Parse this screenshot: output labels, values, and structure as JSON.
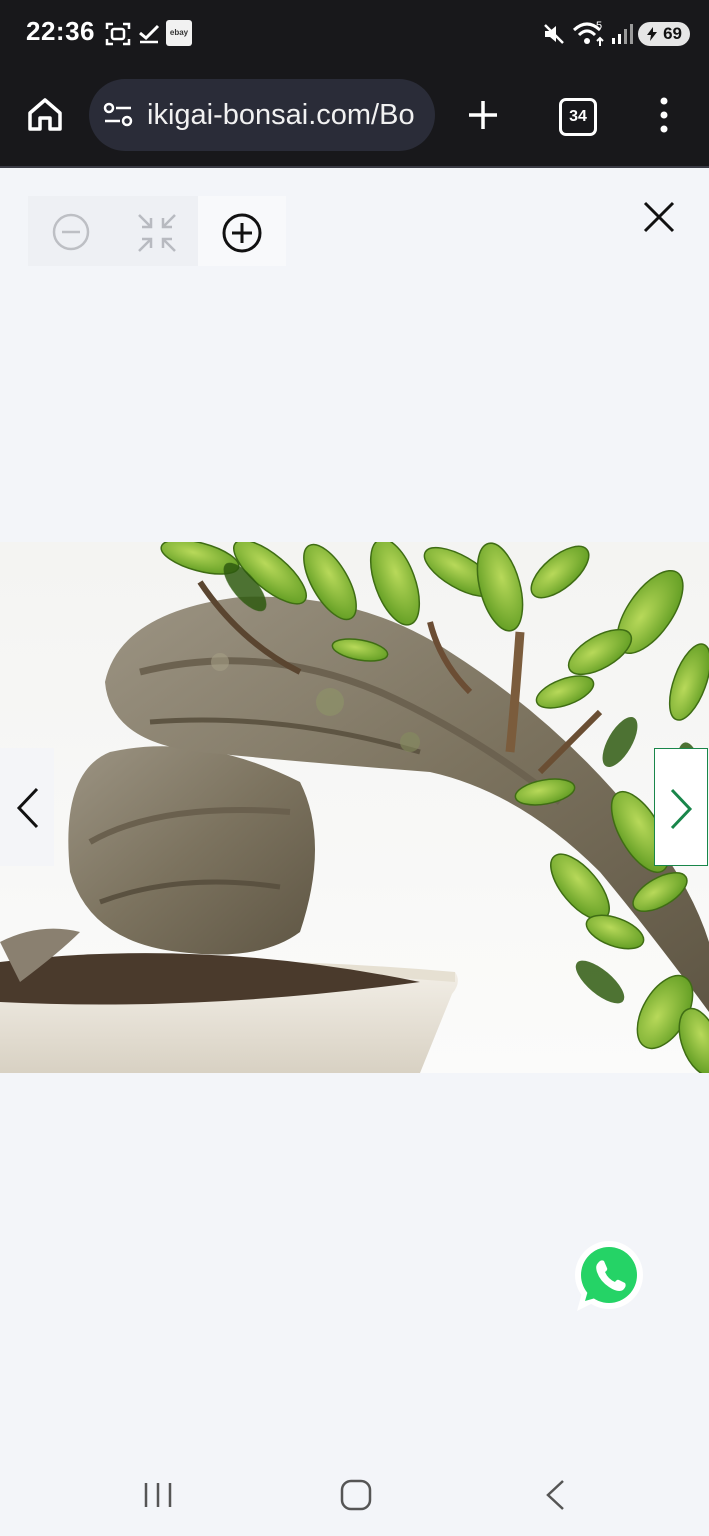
{
  "status_bar": {
    "time": "22:36",
    "icons": [
      "screenshot-icon",
      "check-icon",
      "ebay-icon",
      "mute-icon",
      "wifi-icon",
      "signal-icon"
    ],
    "ebay_label": "ebay",
    "wifi_label": "5",
    "battery": "69"
  },
  "browser": {
    "url": "ikigai-bonsai.com/Bo",
    "tab_count": "34"
  },
  "viewer": {
    "image_alt": "Bonsai tree trunk with leaves in a ceramic pot",
    "zoom_controls": [
      "zoom-out",
      "collapse",
      "zoom-in"
    ]
  },
  "colors": {
    "status_bg": "#18181b",
    "page_bg": "#f3f5f9",
    "accent_green": "#19864a",
    "whatsapp": "#25d366"
  }
}
